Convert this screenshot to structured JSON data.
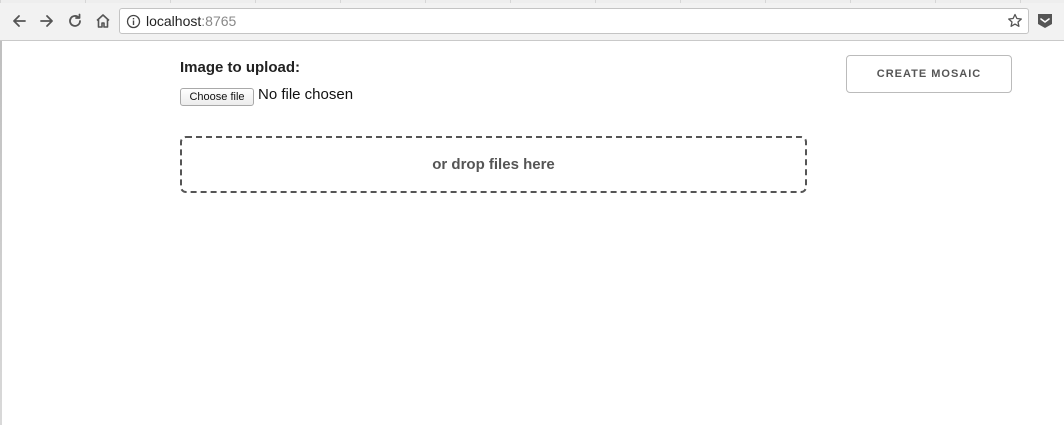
{
  "browser": {
    "url_host": "localhost",
    "url_port": ":8765",
    "icons": [
      "back-arrow-icon",
      "forward-arrow-icon",
      "reload-icon",
      "home-icon",
      "info-icon",
      "bookmark-star-icon",
      "extension-icon"
    ]
  },
  "upload": {
    "label": "Image to upload:",
    "choose_button": "Choose file",
    "file_status": "No file chosen",
    "dropzone_text": "or drop files here"
  },
  "actions": {
    "create_button": "CREATE MOSAIC"
  }
}
